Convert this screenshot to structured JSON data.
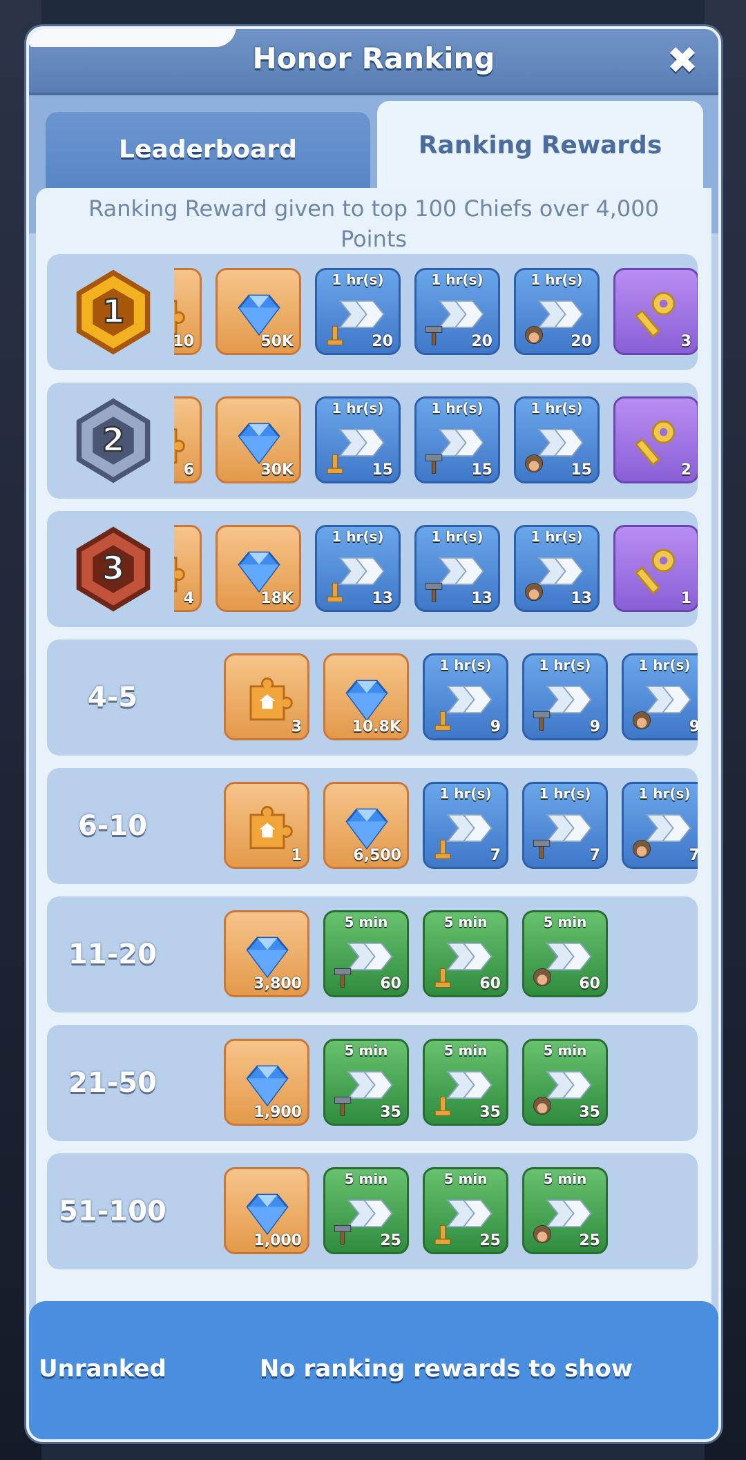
{
  "window": {
    "title": "Honor Ranking",
    "close_glyph": "✖"
  },
  "tabs": [
    {
      "label": "Leaderboard",
      "active": false
    },
    {
      "label": "Ranking Rewards",
      "active": true
    }
  ],
  "subtitle": "Ranking Reward given to top 100 Chiefs over 4,000 Points",
  "rows": [
    {
      "rank": "1",
      "badge": "gold",
      "items": [
        {
          "icon": "puzzle-piece-icon",
          "type": "orange",
          "qty": "10"
        },
        {
          "icon": "gem-icon",
          "type": "orange",
          "qty": "50K"
        },
        {
          "icon": "speedup-research-icon",
          "type": "blue",
          "duration": "1 hr(s)",
          "qty": "20"
        },
        {
          "icon": "speedup-build-icon",
          "type": "blue",
          "duration": "1 hr(s)",
          "qty": "20"
        },
        {
          "icon": "speedup-train-icon",
          "type": "blue",
          "duration": "1 hr(s)",
          "qty": "20"
        },
        {
          "icon": "key-icon",
          "type": "purple",
          "qty": "3"
        }
      ]
    },
    {
      "rank": "2",
      "badge": "silver",
      "items": [
        {
          "icon": "puzzle-piece-icon",
          "type": "orange",
          "qty": "6"
        },
        {
          "icon": "gem-icon",
          "type": "orange",
          "qty": "30K"
        },
        {
          "icon": "speedup-research-icon",
          "type": "blue",
          "duration": "1 hr(s)",
          "qty": "15"
        },
        {
          "icon": "speedup-build-icon",
          "type": "blue",
          "duration": "1 hr(s)",
          "qty": "15"
        },
        {
          "icon": "speedup-train-icon",
          "type": "blue",
          "duration": "1 hr(s)",
          "qty": "15"
        },
        {
          "icon": "key-icon",
          "type": "purple",
          "qty": "2"
        }
      ]
    },
    {
      "rank": "3",
      "badge": "bronze",
      "items": [
        {
          "icon": "puzzle-piece-icon",
          "type": "orange",
          "qty": "4"
        },
        {
          "icon": "gem-icon",
          "type": "orange",
          "qty": "18K"
        },
        {
          "icon": "speedup-research-icon",
          "type": "blue",
          "duration": "1 hr(s)",
          "qty": "13"
        },
        {
          "icon": "speedup-build-icon",
          "type": "blue",
          "duration": "1 hr(s)",
          "qty": "13"
        },
        {
          "icon": "speedup-train-icon",
          "type": "blue",
          "duration": "1 hr(s)",
          "qty": "13"
        },
        {
          "icon": "key-icon",
          "type": "purple",
          "qty": "1"
        }
      ]
    },
    {
      "rank": "4-5",
      "items": [
        {
          "icon": "puzzle-piece-icon",
          "type": "orange",
          "qty": "3"
        },
        {
          "icon": "gem-icon",
          "type": "orange",
          "qty": "10.8K"
        },
        {
          "icon": "speedup-research-icon",
          "type": "blue",
          "duration": "1 hr(s)",
          "qty": "9"
        },
        {
          "icon": "speedup-build-icon",
          "type": "blue",
          "duration": "1 hr(s)",
          "qty": "9"
        },
        {
          "icon": "speedup-train-icon",
          "type": "blue",
          "duration": "1 hr(s)",
          "qty": "9"
        }
      ]
    },
    {
      "rank": "6-10",
      "items": [
        {
          "icon": "puzzle-piece-icon",
          "type": "orange",
          "qty": "1"
        },
        {
          "icon": "gem-icon",
          "type": "orange",
          "qty": "6,500"
        },
        {
          "icon": "speedup-research-icon",
          "type": "blue",
          "duration": "1 hr(s)",
          "qty": "7"
        },
        {
          "icon": "speedup-build-icon",
          "type": "blue",
          "duration": "1 hr(s)",
          "qty": "7"
        },
        {
          "icon": "speedup-train-icon",
          "type": "blue",
          "duration": "1 hr(s)",
          "qty": "7"
        }
      ]
    },
    {
      "rank": "11-20",
      "items": [
        {
          "icon": "gem-icon",
          "type": "orange",
          "qty": "3,800"
        },
        {
          "icon": "speedup-build-icon",
          "type": "green",
          "duration": "5 min",
          "qty": "60"
        },
        {
          "icon": "speedup-research-icon",
          "type": "green",
          "duration": "5 min",
          "qty": "60"
        },
        {
          "icon": "speedup-train-icon",
          "type": "green",
          "duration": "5 min",
          "qty": "60"
        }
      ]
    },
    {
      "rank": "21-50",
      "items": [
        {
          "icon": "gem-icon",
          "type": "orange",
          "qty": "1,900"
        },
        {
          "icon": "speedup-build-icon",
          "type": "green",
          "duration": "5 min",
          "qty": "35"
        },
        {
          "icon": "speedup-research-icon",
          "type": "green",
          "duration": "5 min",
          "qty": "35"
        },
        {
          "icon": "speedup-train-icon",
          "type": "green",
          "duration": "5 min",
          "qty": "35"
        }
      ]
    },
    {
      "rank": "51-100",
      "items": [
        {
          "icon": "gem-icon",
          "type": "orange",
          "qty": "1,000"
        },
        {
          "icon": "speedup-build-icon",
          "type": "green",
          "duration": "5 min",
          "qty": "25"
        },
        {
          "icon": "speedup-research-icon",
          "type": "green",
          "duration": "5 min",
          "qty": "25"
        },
        {
          "icon": "speedup-train-icon",
          "type": "green",
          "duration": "5 min",
          "qty": "25"
        }
      ]
    }
  ],
  "footer": {
    "label": "Unranked",
    "message": "No ranking rewards to show"
  },
  "colors": {
    "panel": "#b9d0ec",
    "header": "#5a7fb6",
    "active_tab": "#e9f4fc",
    "footer": "#4a8ee0"
  }
}
